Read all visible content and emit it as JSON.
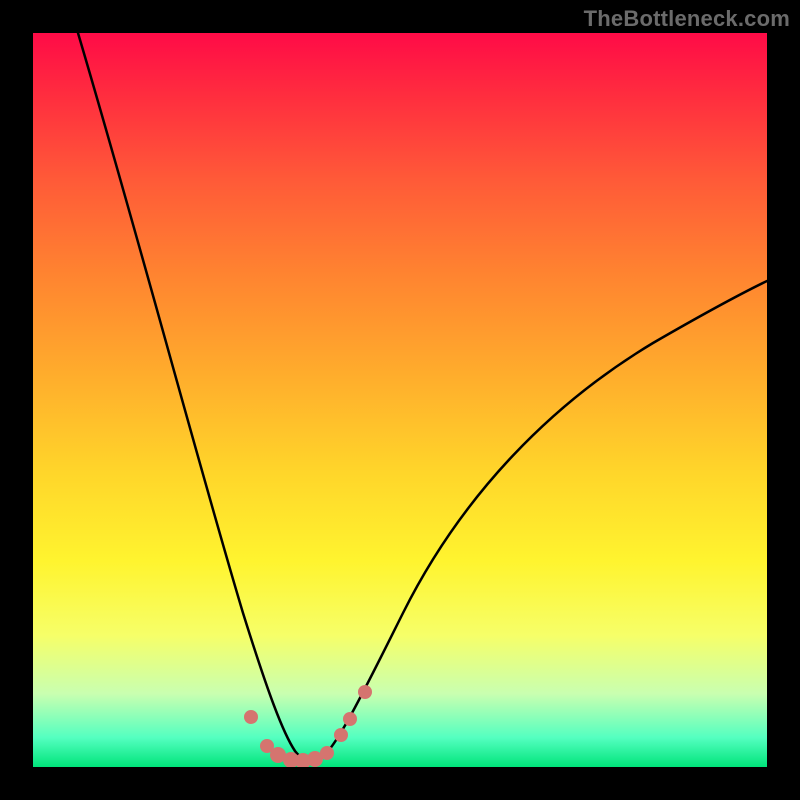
{
  "watermark": "TheBottleneck.com",
  "chart_data": {
    "type": "line",
    "title": "",
    "xlabel": "",
    "ylabel": "",
    "x": [
      0.0,
      0.05,
      0.1,
      0.15,
      0.2,
      0.25,
      0.28,
      0.3,
      0.32,
      0.34,
      0.36,
      0.38,
      0.4,
      0.42,
      0.45,
      0.5,
      0.55,
      0.6,
      0.65,
      0.7,
      0.75,
      0.8,
      0.85,
      0.9,
      0.95,
      1.0
    ],
    "values": [
      1.0,
      0.83,
      0.66,
      0.49,
      0.32,
      0.16,
      0.07,
      0.03,
      0.01,
      0.0,
      0.0,
      0.0,
      0.01,
      0.03,
      0.07,
      0.14,
      0.2,
      0.27,
      0.33,
      0.39,
      0.44,
      0.49,
      0.54,
      0.58,
      0.62,
      0.66
    ],
    "xlim": [
      0,
      1
    ],
    "ylim": [
      0,
      1
    ],
    "markers": {
      "x": [
        0.3,
        0.32,
        0.335,
        0.35,
        0.365,
        0.38,
        0.395,
        0.415,
        0.43,
        0.45
      ],
      "y": [
        0.06,
        0.02,
        0.01,
        0.0,
        0.0,
        0.005,
        0.015,
        0.04,
        0.065,
        0.105
      ],
      "color": "#d5746f"
    },
    "gradient_stops": [
      {
        "pos": 0.0,
        "color": "#ff0b47"
      },
      {
        "pos": 0.5,
        "color": "#ffd62a"
      },
      {
        "pos": 0.82,
        "color": "#f6ff68"
      },
      {
        "pos": 1.0,
        "color": "#00e47a"
      }
    ]
  }
}
